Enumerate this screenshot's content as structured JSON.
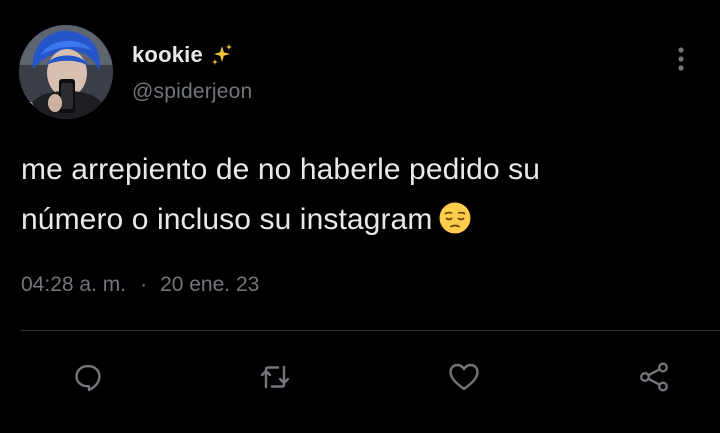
{
  "tweet": {
    "display_name": "kookie",
    "name_emoji_icon": "sparkles-icon",
    "handle": "@spiderjeon",
    "text_line1": "me arrepiento de no haberle pedido su",
    "text_line2": "número o incluso su instagram",
    "text_emoji_icon": "pensive-face-icon",
    "time": "04:28 a. m.",
    "separator": "·",
    "date": "20 ene. 23"
  },
  "actions": [
    {
      "name": "reply",
      "icon": "reply-icon"
    },
    {
      "name": "retweet",
      "icon": "retweet-icon"
    },
    {
      "name": "like",
      "icon": "heart-icon"
    },
    {
      "name": "share",
      "icon": "share-icon"
    }
  ],
  "colors": {
    "background": "#000000",
    "text_primary": "#e7e9ea",
    "text_secondary": "#71767b",
    "divider": "#2f3336",
    "sparkles": "#f5c542"
  }
}
